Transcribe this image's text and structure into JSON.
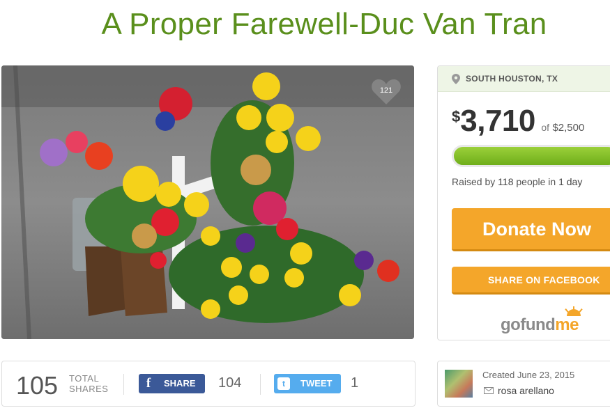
{
  "campaign": {
    "title": "A Proper Farewell-Duc Van Tran",
    "hearts": "121",
    "location": "SOUTH HOUSTON, TX",
    "currency_symbol": "$",
    "raised_amount": "3,710",
    "of_text": "of",
    "goal": "$2,500",
    "progress_fraction": 1.0,
    "raised_by_prefix": "Raised by",
    "donor_count": "118",
    "people_text": "people in",
    "duration": "1 day",
    "donate_label": "Donate Now",
    "share_facebook_label": "SHARE ON FACEBOOK",
    "logo_text_a": "gofund",
    "logo_text_b": "me"
  },
  "shares": {
    "total": "105",
    "label_line1": "TOTAL",
    "label_line2": "SHARES",
    "facebook_label": "SHARE",
    "facebook_glyph": "f",
    "facebook_count": "104",
    "twitter_label": "TWEET",
    "twitter_glyph": "t",
    "twitter_count": "1"
  },
  "organizer": {
    "created": "Created June 23, 2015",
    "name": "rosa arellano"
  },
  "colors": {
    "title_green": "#5a8f1c",
    "accent_orange": "#f4a62a",
    "progress_green": "#7cbf24",
    "facebook_blue": "#3b5998",
    "twitter_blue": "#55acee"
  },
  "icons": [
    "heart-icon",
    "location-pin-icon",
    "facebook-icon",
    "twitter-icon",
    "mail-icon",
    "sun-logo-icon"
  ]
}
